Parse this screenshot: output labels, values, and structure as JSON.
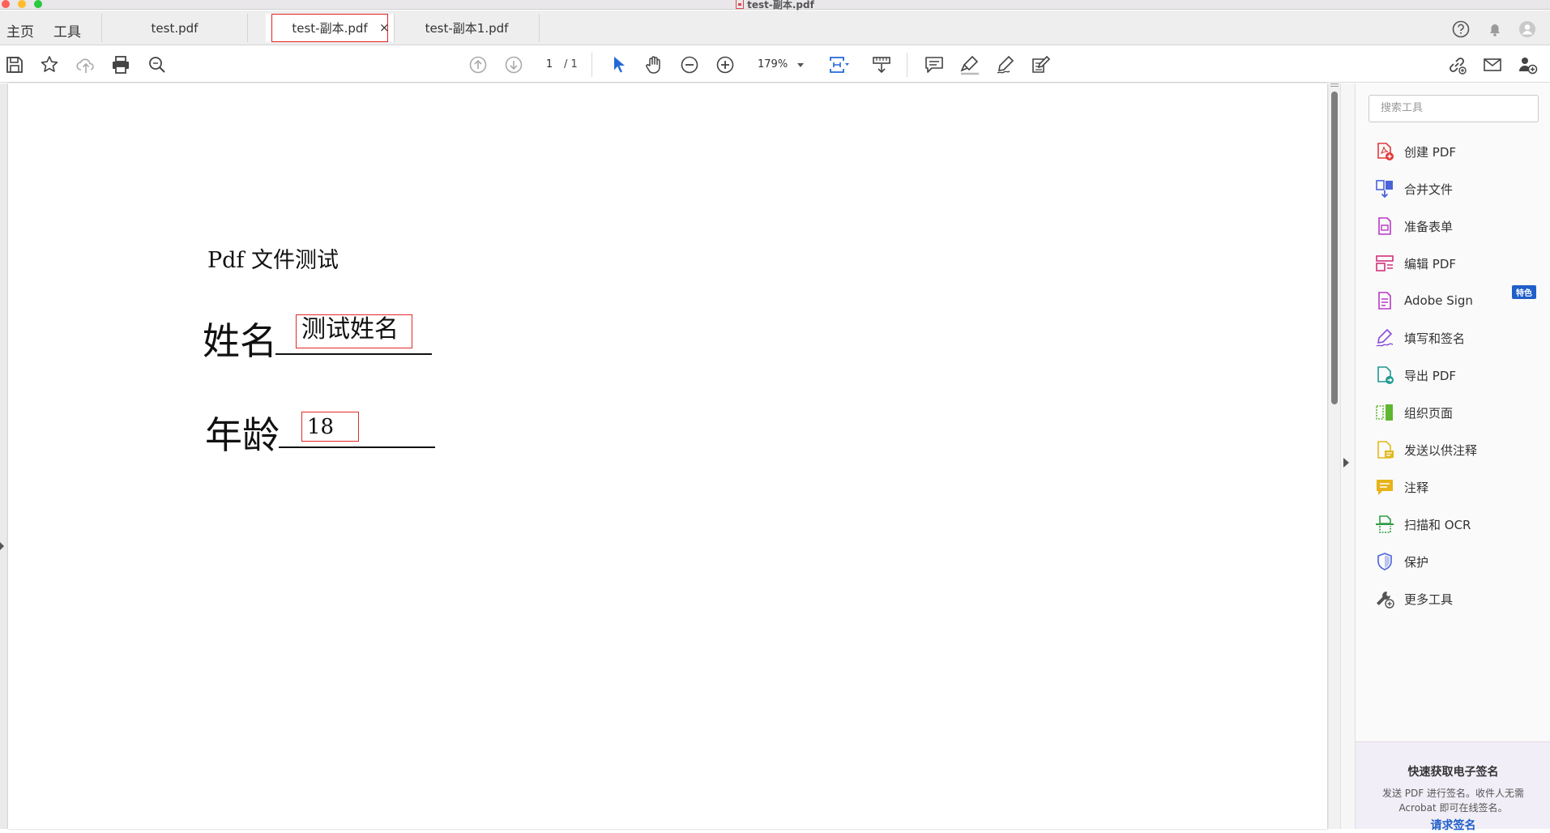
{
  "window": {
    "title": "test-副本.pdf"
  },
  "nav": {
    "home": "主页",
    "tools": "工具"
  },
  "tabs": [
    {
      "label": "test.pdf",
      "active": false
    },
    {
      "label": "test-副本.pdf",
      "active": true
    },
    {
      "label": "test-副本1.pdf",
      "active": false
    }
  ],
  "tab_close": "×",
  "toolbar": {
    "page_current": "1",
    "page_total": "/ 1",
    "zoom": "179%"
  },
  "document": {
    "heading": "Pdf 文件测试",
    "name_label": "姓名",
    "name_value": "测试姓名",
    "age_label": "年龄",
    "age_value": "18"
  },
  "tools_pane": {
    "search_placeholder": "搜索工具",
    "items": [
      {
        "label": "创建 PDF",
        "icon": "create-pdf-icon",
        "color": "#e1393a"
      },
      {
        "label": "合并文件",
        "icon": "combine-files-icon",
        "color": "#4a63d9"
      },
      {
        "label": "准备表单",
        "icon": "prepare-form-icon",
        "color": "#b739c5"
      },
      {
        "label": "编辑 PDF",
        "icon": "edit-pdf-icon",
        "color": "#d2317c"
      },
      {
        "label": "Adobe Sign",
        "icon": "adobe-sign-icon",
        "color": "#b739c5"
      },
      {
        "label": "填写和签名",
        "icon": "fill-sign-icon",
        "color": "#8b49d8"
      },
      {
        "label": "导出 PDF",
        "icon": "export-pdf-icon",
        "color": "#1f9a92"
      },
      {
        "label": "组织页面",
        "icon": "organize-pages-icon",
        "color": "#5fb72f"
      },
      {
        "label": "发送以供注释",
        "icon": "send-comments-icon",
        "color": "#e3b81c"
      },
      {
        "label": "注释",
        "icon": "comment-icon",
        "color": "#e6b41a"
      },
      {
        "label": "扫描和 OCR",
        "icon": "scan-ocr-icon",
        "color": "#2f9c46"
      },
      {
        "label": "保护",
        "icon": "protect-icon",
        "color": "#4a63d9"
      },
      {
        "label": "更多工具",
        "icon": "more-tools-icon",
        "color": "#555555"
      }
    ],
    "badge": "特色",
    "promo": {
      "title": "快速获取电子签名",
      "text": "发送 PDF 进行签名。收件人无需 Acrobat 即可在线签名。",
      "link": "请求签名"
    }
  }
}
